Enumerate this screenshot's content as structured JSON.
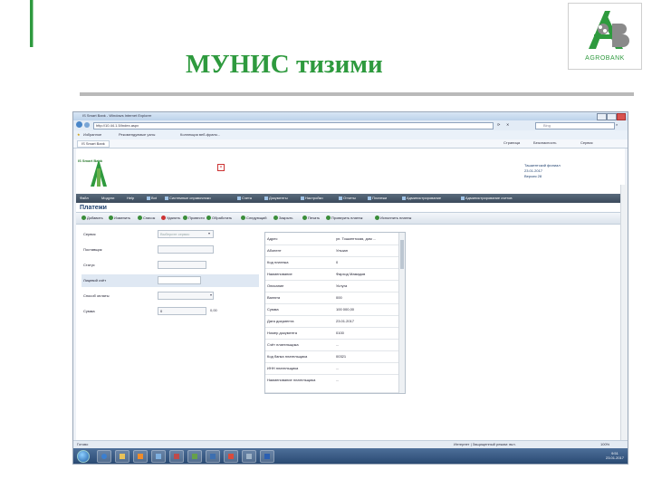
{
  "slide": {
    "title": "МУНИС тизими",
    "logo_text": "AGROBANK",
    "logo_colors": {
      "green": "#2e9a3e",
      "grey": "#8a8a8a"
    }
  },
  "browser": {
    "window_title": "IS Smart Bank - Windows Internet Explorer",
    "address": "http://10.44.1.5/Index.aspx",
    "search_placeholder": "Bing",
    "favorites": [
      "Избранное",
      "Рекомендуемые узлы",
      "Коллекция веб-фрагм..."
    ],
    "tab_title": "IS Smart Bank",
    "command_bar": [
      "Страница",
      "Безопасность",
      "Сервис"
    ],
    "status_left": "Готово",
    "status_right": "Интернет | Защищенный режим: вкл.",
    "zoom": "100%"
  },
  "app": {
    "name": "IS Smart Bank",
    "header_info": [
      "Ташкентский филиал",
      "23.01.2017",
      "Версия 28"
    ],
    "menu": [
      "Файл",
      "Модули",
      "Help",
      "Bot",
      "Системные справочники",
      "Счета",
      "Документы",
      "Настройки",
      "Отчеты",
      "Платежи",
      "Администрирование",
      "Администрирование счетов"
    ],
    "page_heading": "Платежи",
    "toolbar": [
      "Добавить",
      "Изменить",
      "Список",
      "Удалить",
      "Провести",
      "Обработать",
      "Следующий",
      "Закрыть",
      "Печать",
      "Проверить платеж",
      "Исполнить платеж"
    ],
    "form": [
      {
        "label": "Сервис",
        "value": "Выберите сервис",
        "type": "select"
      },
      {
        "label": "Поставщик",
        "value": "",
        "type": "text"
      },
      {
        "label": "Статус",
        "value": "",
        "type": "text"
      },
      {
        "label": "Лицевой счёт",
        "value": "",
        "type": "text",
        "highlight": true
      },
      {
        "label": "Способ оплаты",
        "value": "",
        "type": "select"
      },
      {
        "label": "Сумма",
        "value": "0",
        "type": "text",
        "suffix": "0,00"
      }
    ],
    "properties": [
      {
        "key": "Адрес",
        "value": "ул. Тошкентская, дом ..."
      },
      {
        "key": "Абонент",
        "value": "Ульзан"
      },
      {
        "key": "Код платежа",
        "value": "0"
      },
      {
        "key": "Наименование",
        "value": "Фарход Мамадов"
      },
      {
        "key": "Описание",
        "value": "Услуга"
      },
      {
        "key": "Валюта",
        "value": "000"
      },
      {
        "key": "Сумма",
        "value": "100 000,00"
      },
      {
        "key": "Дата документа",
        "value": "23.01.2017"
      },
      {
        "key": "Номер документа",
        "value": "0100"
      },
      {
        "key": "Счёт плательщика",
        "value": "..."
      },
      {
        "key": "Код банка плательщика",
        "value": "00321"
      },
      {
        "key": "ИНН плательщика",
        "value": "..."
      },
      {
        "key": "Наименование плательщика",
        "value": "..."
      }
    ],
    "clock_time": "9:51",
    "clock_date": "23.01.2017"
  }
}
